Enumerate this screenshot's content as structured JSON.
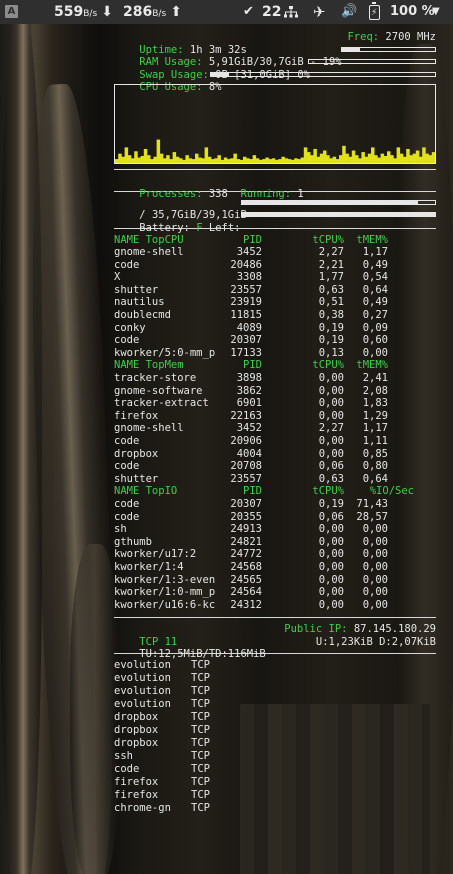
{
  "topbar": {
    "app_icon_letter": "A",
    "download": {
      "value": "559",
      "unit": "B/s",
      "arrow": "⬇"
    },
    "upload": {
      "value": "286",
      "unit": "B/s",
      "arrow": "⬆"
    },
    "updates_icon": "check-icon",
    "updates_count": "22",
    "network_icon": "network-icon",
    "airplane_icon": "airplane-icon",
    "volume_icon": "volume-icon",
    "battery_icon": "battery-charging-icon",
    "battery_percent": "100 %",
    "menu_icon": "chevron-down-icon"
  },
  "system": {
    "uptime_label": "Uptime:",
    "uptime_value": "1h 3m 32s",
    "freq_label": "Freq:",
    "freq_value": "2700 MHz",
    "ram_label": "RAM Usage:",
    "ram_value": "5,91GiB/30,7GiB - 19%",
    "ram_fraction": 0.19,
    "swap_label": "Swap Usage:",
    "swap_value": "0B [31,0GiB] 0%",
    "swap_fraction": 0.0,
    "cpu_label": "CPU Usage:",
    "cpu_value": "8%",
    "cpu_fraction": 0.08,
    "processes_label": "Processes:",
    "processes_value": "338",
    "running_label": "Running:",
    "running_value": "1"
  },
  "disk": {
    "root_label": "/",
    "root_value": "35,7GiB/39,1GiB",
    "root_fraction": 0.91,
    "battery_label": "Battery:",
    "battery_state": "F",
    "battery_left_label": "Left:",
    "battery_fraction": 1.0
  },
  "cpu_graph_levels": [
    0.05,
    0.12,
    0.08,
    0.2,
    0.1,
    0.06,
    0.15,
    0.07,
    0.09,
    0.18,
    0.1,
    0.05,
    0.08,
    0.3,
    0.12,
    0.06,
    0.1,
    0.05,
    0.14,
    0.08,
    0.06,
    0.04,
    0.1,
    0.06,
    0.05,
    0.12,
    0.07,
    0.06,
    0.2,
    0.08,
    0.05,
    0.06,
    0.1,
    0.04,
    0.07,
    0.05,
    0.06,
    0.12,
    0.05,
    0.04,
    0.08,
    0.06,
    0.05,
    0.1,
    0.06,
    0.04,
    0.05,
    0.07,
    0.05,
    0.06,
    0.04,
    0.05,
    0.08,
    0.06,
    0.05,
    0.04,
    0.06,
    0.05,
    0.07,
    0.2,
    0.14,
    0.1,
    0.18,
    0.08,
    0.12,
    0.16,
    0.1,
    0.06,
    0.08,
    0.05,
    0.1,
    0.22,
    0.12,
    0.08,
    0.16,
    0.1,
    0.06,
    0.14,
    0.08,
    0.12,
    0.2,
    0.1,
    0.07,
    0.12,
    0.09,
    0.15,
    0.1,
    0.06,
    0.2,
    0.12,
    0.08,
    0.18,
    0.1,
    0.12,
    0.16,
    0.08,
    0.2,
    0.12,
    0.1,
    0.14
  ],
  "top_cpu": {
    "header": {
      "name": "NAME TopCPU",
      "pid": "PID",
      "cpu": "tCPU%",
      "mem": "tMEM%"
    },
    "rows": [
      {
        "name": "gnome-shell",
        "pid": "3452",
        "cpu": "2,27",
        "mem": "1,17"
      },
      {
        "name": "code",
        "pid": "20486",
        "cpu": "2,21",
        "mem": "0,49"
      },
      {
        "name": "X",
        "pid": "3308",
        "cpu": "1,77",
        "mem": "0,54"
      },
      {
        "name": "shutter",
        "pid": "23557",
        "cpu": "0,63",
        "mem": "0,64"
      },
      {
        "name": "nautilus",
        "pid": "23919",
        "cpu": "0,51",
        "mem": "0,49"
      },
      {
        "name": "doublecmd",
        "pid": "11815",
        "cpu": "0,38",
        "mem": "0,27"
      },
      {
        "name": "conky",
        "pid": "4089",
        "cpu": "0,19",
        "mem": "0,09"
      },
      {
        "name": "code",
        "pid": "20307",
        "cpu": "0,19",
        "mem": "0,60"
      },
      {
        "name": "kworker/5:0-mm_p",
        "pid": "17133",
        "cpu": "0,13",
        "mem": "0,00"
      }
    ]
  },
  "top_mem": {
    "header": {
      "name": "NAME TopMem",
      "pid": "PID",
      "cpu": "tCPU%",
      "mem": "tMEM%"
    },
    "rows": [
      {
        "name": "tracker-store",
        "pid": "3898",
        "cpu": "0,00",
        "mem": "2,41"
      },
      {
        "name": "gnome-software",
        "pid": "3862",
        "cpu": "0,00",
        "mem": "2,08"
      },
      {
        "name": "tracker-extract",
        "pid": "6901",
        "cpu": "0,00",
        "mem": "1,83"
      },
      {
        "name": "firefox",
        "pid": "22163",
        "cpu": "0,00",
        "mem": "1,29"
      },
      {
        "name": "gnome-shell",
        "pid": "3452",
        "cpu": "2,27",
        "mem": "1,17"
      },
      {
        "name": "code",
        "pid": "20906",
        "cpu": "0,00",
        "mem": "1,11"
      },
      {
        "name": "dropbox",
        "pid": "4004",
        "cpu": "0,00",
        "mem": "0,85"
      },
      {
        "name": "code",
        "pid": "20708",
        "cpu": "0,06",
        "mem": "0,80"
      },
      {
        "name": "shutter",
        "pid": "23557",
        "cpu": "0,63",
        "mem": "0,64"
      }
    ]
  },
  "top_io": {
    "header": {
      "name": "NAME TopIO",
      "pid": "PID",
      "cpu": "tCPU%",
      "mem": "%IO/Sec"
    },
    "rows": [
      {
        "name": "code",
        "pid": "20307",
        "cpu": "0,19",
        "mem": "71,43"
      },
      {
        "name": "code",
        "pid": "20355",
        "cpu": "0,06",
        "mem": "28,57"
      },
      {
        "name": "sh",
        "pid": "24913",
        "cpu": "0,00",
        "mem": "0,00"
      },
      {
        "name": "gthumb",
        "pid": "24821",
        "cpu": "0,00",
        "mem": "0,00"
      },
      {
        "name": "kworker/u17:2",
        "pid": "24772",
        "cpu": "0,00",
        "mem": "0,00"
      },
      {
        "name": "kworker/1:4",
        "pid": "24568",
        "cpu": "0,00",
        "mem": "0,00"
      },
      {
        "name": "kworker/1:3-even",
        "pid": "24565",
        "cpu": "0,00",
        "mem": "0,00"
      },
      {
        "name": "kworker/1:0-mm_p",
        "pid": "24564",
        "cpu": "0,00",
        "mem": "0,00"
      },
      {
        "name": "kworker/u16:6-kc",
        "pid": "24312",
        "cpu": "0,00",
        "mem": "0,00"
      }
    ]
  },
  "network": {
    "tcp_label": "TCP",
    "tcp_count": "11",
    "public_ip_label": "Public IP:",
    "public_ip": "87.145.180.29",
    "totals": "TU:12,5MiB/TD:116MiB",
    "speeds": "U:1,23KiB D:2,07KiB"
  },
  "connections": [
    {
      "process": "evolution",
      "proto": "TCP"
    },
    {
      "process": "evolution",
      "proto": "TCP"
    },
    {
      "process": "evolution",
      "proto": "TCP"
    },
    {
      "process": "evolution",
      "proto": "TCP"
    },
    {
      "process": "dropbox",
      "proto": "TCP"
    },
    {
      "process": "dropbox",
      "proto": "TCP"
    },
    {
      "process": "dropbox",
      "proto": "TCP"
    },
    {
      "process": "ssh",
      "proto": "TCP"
    },
    {
      "process": "code",
      "proto": "TCP"
    },
    {
      "process": "firefox",
      "proto": "TCP"
    },
    {
      "process": "firefox",
      "proto": "TCP"
    },
    {
      "process": "chrome-gn",
      "proto": "TCP"
    }
  ],
  "colors": {
    "accent_green": "#3ed04a",
    "graph_yellow": "#e2e21a",
    "text": "#e6e6e6",
    "topbar_bg": "#2f2f2f"
  }
}
